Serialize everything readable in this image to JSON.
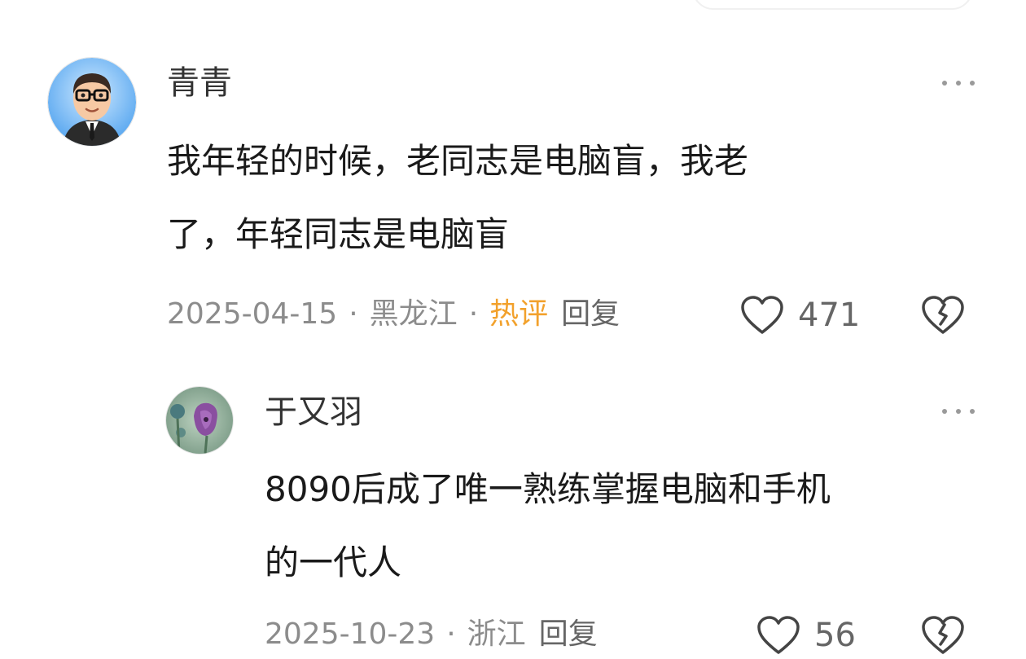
{
  "comments": [
    {
      "username": "青青",
      "text_lines": [
        "我年轻的时候，老同志是电脑盲，我老",
        "了，年轻同志是电脑盲"
      ],
      "date": "2025-04-15",
      "location": "黑龙江",
      "hot_label": "热评",
      "reply_label": "回复",
      "likes": "471",
      "avatar": "cartoon-man-glasses-avatar"
    },
    {
      "username": "于又羽",
      "text_lines": [
        "8090后成了唯一熟练掌握电脑和手机",
        "的一代人"
      ],
      "date": "2025-10-23",
      "location": "浙江",
      "reply_label": "回复",
      "likes": "56",
      "avatar": "purple-flower-avatar"
    }
  ],
  "separator": "·",
  "colors": {
    "hot": "#f2a12c",
    "meta": "#8c8c8c",
    "text": "#1a1a1a"
  }
}
